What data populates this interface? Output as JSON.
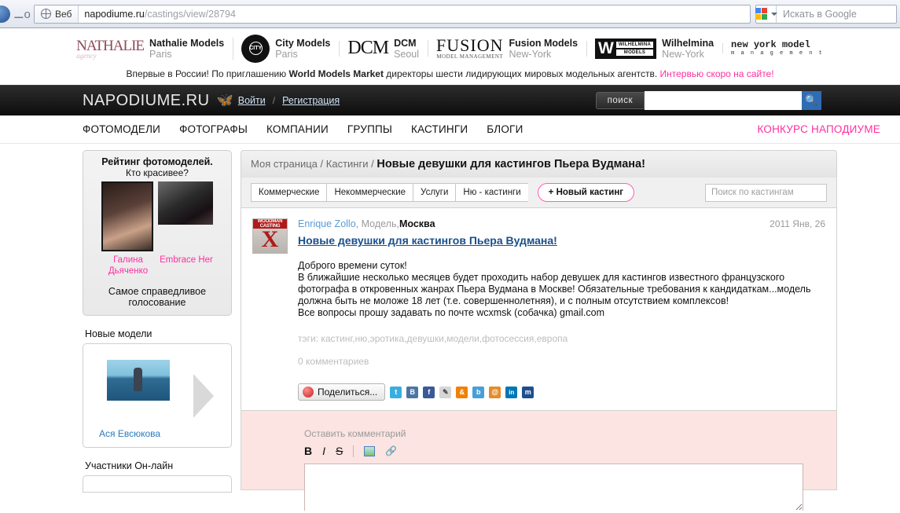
{
  "browser": {
    "scope_label": "Веб",
    "url_host": "napodiume.ru",
    "url_path": "/castings/view/28794",
    "google_placeholder": "Искать в Google",
    "back_icon": "back-arrow-icon",
    "key_icon": "key-icon",
    "globe_icon": "globe-icon",
    "google_icon": "google-icon",
    "caret_icon": "chevron-down-icon"
  },
  "partners": [
    {
      "logo": "NATHALIE",
      "logo_sub": "agency",
      "name": "Nathalie Models",
      "city": "Paris"
    },
    {
      "logo": "CITY",
      "logo_sub": "",
      "name": "City Models",
      "city": "Paris"
    },
    {
      "logo": "DCM",
      "logo_sub": "",
      "name": "DCM",
      "city": "Seoul"
    },
    {
      "logo": "FUSION",
      "logo_sub": "MODEL MANAGEMENT",
      "name": "Fusion Models",
      "city": "New-York"
    },
    {
      "logo": "W",
      "logo_sub": "WILHELMINA MODELS",
      "name": "Wilhelmina",
      "city": "New-York"
    },
    {
      "logo": "new york model",
      "logo_sub": "m a n a g e m e n t",
      "name": "",
      "city": ""
    }
  ],
  "announcement": {
    "part1": "Впервые в России! По приглашению ",
    "bold": "World Models Market",
    "part2": " директоры шести лидирующих мировых модельных агентств. ",
    "pink": "Интервью скоро на сайте!"
  },
  "header": {
    "brand": "NAPODIUME.RU",
    "butterfly_icon": "butterfly-icon",
    "login": "Войти",
    "separator": "/",
    "register": "Регистрация",
    "search_button": "поиск",
    "search_value": "",
    "search_placeholder": "",
    "search_icon": "search-icon"
  },
  "nav": {
    "items": [
      "ФОТОМОДЕЛИ",
      "ФОТОГРАФЫ",
      "КОМПАНИИ",
      "ГРУППЫ",
      "КАСТИНГИ",
      "БЛОГИ"
    ],
    "contest": "КОНКУРС НАПОДИУМЕ"
  },
  "sidebar": {
    "rating": {
      "title": "Рейтинг фотомоделей.",
      "subtitle": "Кто красивее?",
      "left_name": "Галина Дьяченко",
      "right_name": "Embrace Her",
      "footer": "Самое справедливое голосование"
    },
    "new_models": {
      "title": "Новые модели",
      "model_name": "Ася Евсюкова",
      "next_icon": "arrow-right-icon"
    },
    "online": {
      "title": "Участники Он-лайн"
    }
  },
  "breadcrumb": {
    "home": "Моя страница",
    "sep1": "/",
    "section": "Кастинги",
    "sep2": "/",
    "current": "Новые девушки для кастингов Пьера Вудмана!"
  },
  "tabs": {
    "items": [
      "Коммерческие",
      "Некоммерческие",
      "Услуги",
      "Ню - кастинги"
    ],
    "new_casting": "+ Новый кастинг",
    "search_placeholder": "Поиск по  кастингам",
    "search_value": ""
  },
  "post": {
    "avatar_top": "WOODMAN CASTING",
    "avatar_x": "X",
    "author": "Enrique Zollo",
    "role": ", Модель, ",
    "city": "Москва",
    "date": "2011 Янв, 26",
    "title": "Новые девушки для кастингов Пьера Вудмана!",
    "body_lines": [
      "Доброго времени суток!",
      "В ближайшие несколько месяцев будет проходить набор девушек для кастингов известного французского",
      "фотографа в откровенных жанрах Пьера Вудмана в Москве! Обязательные требования к кандидаткам...модель",
      "должна быть не моложе 18 лет (т.е. совершеннолетняя), и с полным отсутствием комплексов!",
      "Все вопросы прошу задавать по почте wcxmsk (собачка) gmail.com"
    ],
    "tags": "тэги: кастинг,ню,эротика,девушки,модели,фотосессия,европа",
    "comments_count": "0 комментариев",
    "share_label": "Поделиться...",
    "share_icons": [
      {
        "name": "twitter-icon",
        "glyph": "t",
        "color": "#3aaee0"
      },
      {
        "name": "vkontakte-icon",
        "glyph": "B",
        "color": "#4c75a3"
      },
      {
        "name": "facebook-icon",
        "glyph": "f",
        "color": "#3b5998"
      },
      {
        "name": "livejournal-icon",
        "glyph": "✎",
        "color": "#d6d6d6"
      },
      {
        "name": "odnoklassniki-icon",
        "glyph": "&",
        "color": "#ee8208"
      },
      {
        "name": "blogger-icon",
        "glyph": "b",
        "color": "#4a9fd5"
      },
      {
        "name": "mailru-icon",
        "glyph": "@",
        "color": "#e58c2a"
      },
      {
        "name": "linkedin-icon",
        "glyph": "in",
        "color": "#0077b5"
      },
      {
        "name": "myspace-icon",
        "glyph": "m",
        "color": "#1e4f8f"
      }
    ]
  },
  "comment_form": {
    "label": "Оставить комментарий",
    "bold": "B",
    "italic": "I",
    "strike": "S",
    "image_icon": "insert-image-icon",
    "link_icon": "insert-link-icon",
    "textarea_value": "",
    "textarea_placeholder": ""
  },
  "colors": {
    "pink": "#ff2fa0",
    "link_blue": "#1a4f8a",
    "comment_bg": "#fbe4e1"
  }
}
